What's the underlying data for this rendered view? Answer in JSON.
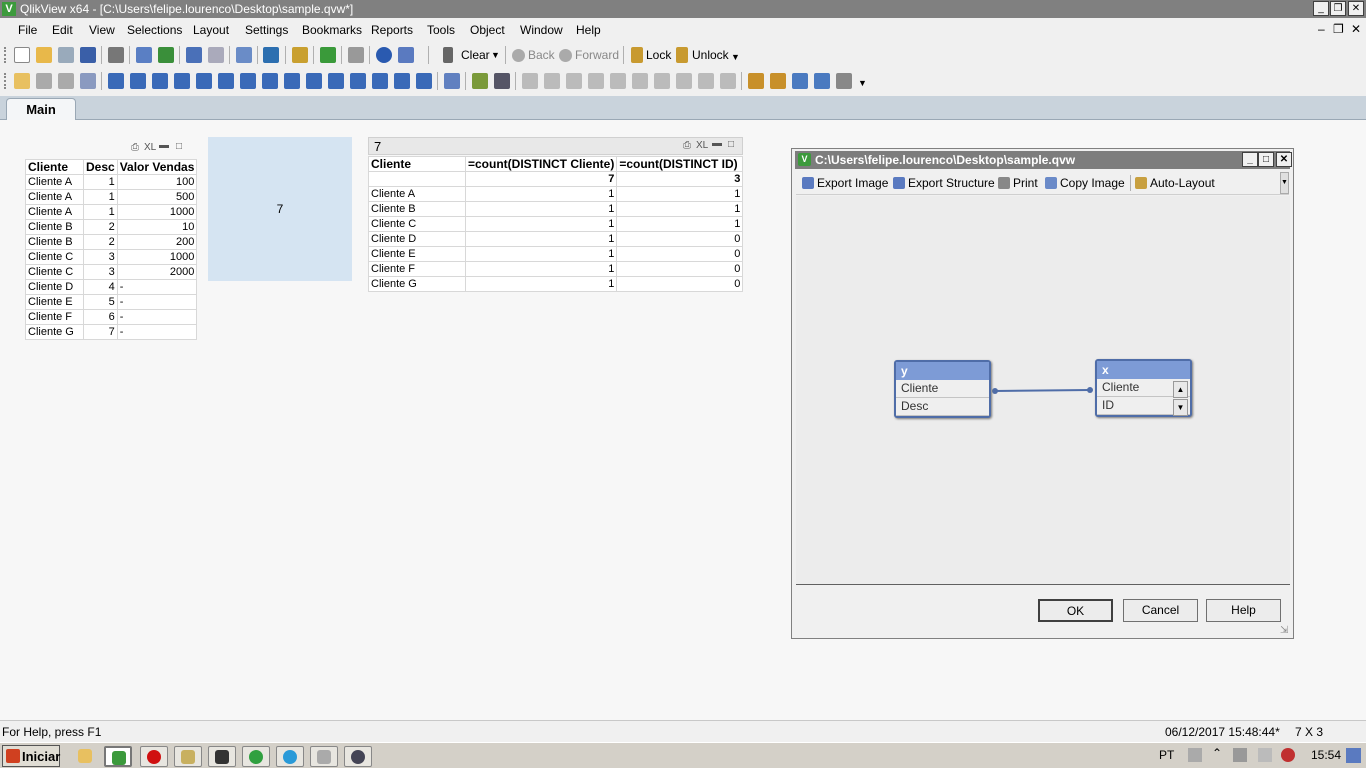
{
  "window": {
    "title": "QlikView x64 - [C:\\Users\\felipe.lourenco\\Desktop\\sample.qvw*]",
    "app_icon": "V"
  },
  "menu": [
    "File",
    "Edit",
    "View",
    "Selections",
    "Layout",
    "Settings",
    "Bookmarks",
    "Reports",
    "Tools",
    "Object",
    "Window",
    "Help"
  ],
  "toolbar": {
    "clear": "Clear",
    "back": "Back",
    "forward": "Forward",
    "lock": "Lock",
    "unlock": "Unlock"
  },
  "tabs": [
    {
      "label": "Main",
      "active": true
    }
  ],
  "table1": {
    "caption_icons": "XL",
    "headers": [
      "Cliente",
      "Desc",
      "Valor Vendas"
    ],
    "rows": [
      [
        "Cliente A",
        "1",
        "100"
      ],
      [
        "Cliente A",
        "1",
        "500"
      ],
      [
        "Cliente A",
        "1",
        "1000"
      ],
      [
        "Cliente B",
        "2",
        "10"
      ],
      [
        "Cliente B",
        "2",
        "200"
      ],
      [
        "Cliente C",
        "3",
        "1000"
      ],
      [
        "Cliente C",
        "3",
        "2000"
      ],
      [
        "Cliente D",
        "4",
        "-"
      ],
      [
        "Cliente E",
        "5",
        "-"
      ],
      [
        "Cliente F",
        "6",
        "-"
      ],
      [
        "Cliente G",
        "7",
        "-"
      ]
    ]
  },
  "text_object": {
    "value": "7"
  },
  "table2": {
    "caption": "7",
    "caption_icons": "XL",
    "headers": [
      "Cliente",
      "=count(DISTINCT Cliente)",
      "=count(DISTINCT ID)"
    ],
    "totals": [
      "",
      "7",
      "3"
    ],
    "rows": [
      [
        "Cliente A",
        "1",
        "1"
      ],
      [
        "Cliente B",
        "1",
        "1"
      ],
      [
        "Cliente C",
        "1",
        "1"
      ],
      [
        "Cliente D",
        "1",
        "0"
      ],
      [
        "Cliente E",
        "1",
        "0"
      ],
      [
        "Cliente F",
        "1",
        "0"
      ],
      [
        "Cliente G",
        "1",
        "0"
      ]
    ]
  },
  "dialog": {
    "title": "C:\\Users\\felipe.lourenco\\Desktop\\sample.qvw",
    "toolbar": [
      "Export Image",
      "Export Structure",
      "Print",
      "Copy Image",
      "Auto-Layout"
    ],
    "tables": [
      {
        "name": "y",
        "fields": [
          "Cliente",
          "Desc"
        ]
      },
      {
        "name": "x",
        "fields": [
          "Cliente",
          "ID"
        ]
      }
    ],
    "buttons": {
      "ok": "OK",
      "cancel": "Cancel",
      "help": "Help"
    }
  },
  "status": {
    "help": "For Help, press F1",
    "datetime": "06/12/2017 15:48:44*",
    "dims": "7 X 3"
  },
  "taskbar": {
    "start": "Iniciar",
    "lang": "PT",
    "clock": "15:54"
  },
  "colors": {
    "titlebar": "#808080",
    "tab_strip": "#c9d3dc",
    "text_object_bg": "#d5e4f2",
    "table_header": "#7d9bd6"
  }
}
